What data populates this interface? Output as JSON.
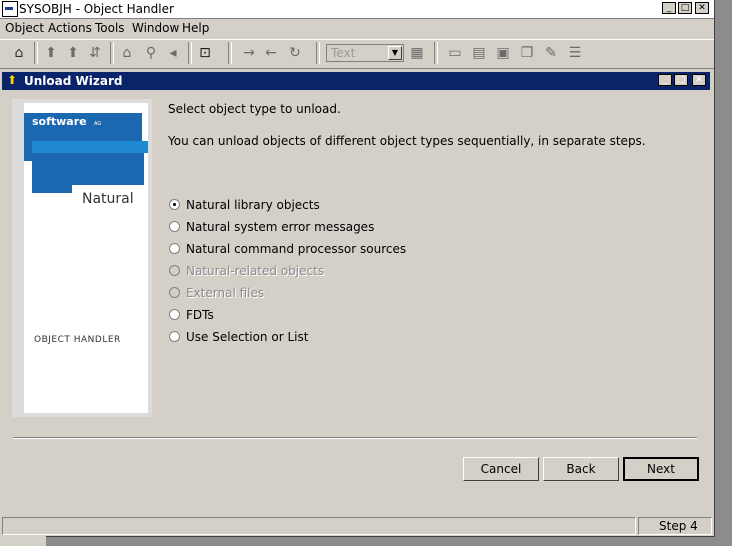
{
  "window": {
    "title": "SYSOBJH - Object Handler"
  },
  "menu": [
    "Object",
    "Actions",
    "Tools",
    "Window",
    "Help"
  ],
  "toolbar": {
    "combo_value": "Text"
  },
  "wizard": {
    "title": "Unload Wizard",
    "brand": {
      "logo": "software",
      "logo_sub": "AG",
      "product": "Natural",
      "caption": "OBJECT HANDLER"
    },
    "prompt": "Select object type to unload.",
    "description": "You can unload objects of different object types sequentially, in separate steps.",
    "options": [
      {
        "label": "Natural library objects",
        "selected": true,
        "enabled": true
      },
      {
        "label": "Natural system error messages",
        "selected": false,
        "enabled": true
      },
      {
        "label": "Natural command processor sources",
        "selected": false,
        "enabled": true
      },
      {
        "label": "Natural-related objects",
        "selected": false,
        "enabled": false
      },
      {
        "label": "External files",
        "selected": false,
        "enabled": false
      },
      {
        "label": "FDTs",
        "selected": false,
        "enabled": true
      },
      {
        "label": "Use Selection or List",
        "selected": false,
        "enabled": true
      }
    ],
    "buttons": {
      "cancel": "Cancel",
      "back": "Back",
      "next": "Next"
    }
  },
  "status": {
    "step": "Step 4"
  },
  "colors": {
    "title_active": "#0a246a",
    "face": "#d4d0c8",
    "brand_blue": "#1b68b0"
  }
}
